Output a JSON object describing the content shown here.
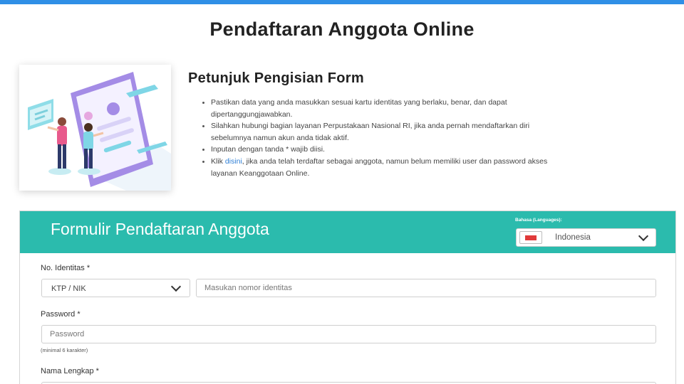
{
  "page_title": "Pendaftaran Anggota Online",
  "guide": {
    "title": "Petunjuk Pengisian Form",
    "items": [
      "Pastikan data yang anda masukkan sesuai kartu identitas yang berlaku, benar, dan dapat dipertanggungjawabkan.",
      "Silahkan hubungi bagian layanan Perpustakaan Nasional RI, jika anda pernah mendaftarkan diri sebelumnya namun akun anda tidak aktif.",
      "Inputan dengan tanda * wajib diisi."
    ],
    "last_item": {
      "prefix": "Klik ",
      "link": "disini",
      "suffix": ", jika anda telah terdaftar sebagai anggota, namun belum memiliki user dan password akses layanan Keanggotaan Online."
    }
  },
  "form": {
    "title": "Formulir Pendaftaran Anggota",
    "language_label": "Bahasa (Languages):",
    "language_value": "Indonesia",
    "identity": {
      "label": "No. Identitas *",
      "type_value": "KTP / NIK",
      "placeholder": "Masukan nomor identitas"
    },
    "password": {
      "label": "Password *",
      "placeholder": "Password",
      "hint": "(minimal 6 karakter)"
    },
    "fullname": {
      "label": "Nama Lengkap *"
    }
  },
  "colors": {
    "top_bar": "#2f8fe6",
    "header_teal": "#2bbbad",
    "link_blue": "#2f7fd6"
  },
  "icons": [
    "chevron-down-icon",
    "indonesia-flag-icon"
  ]
}
